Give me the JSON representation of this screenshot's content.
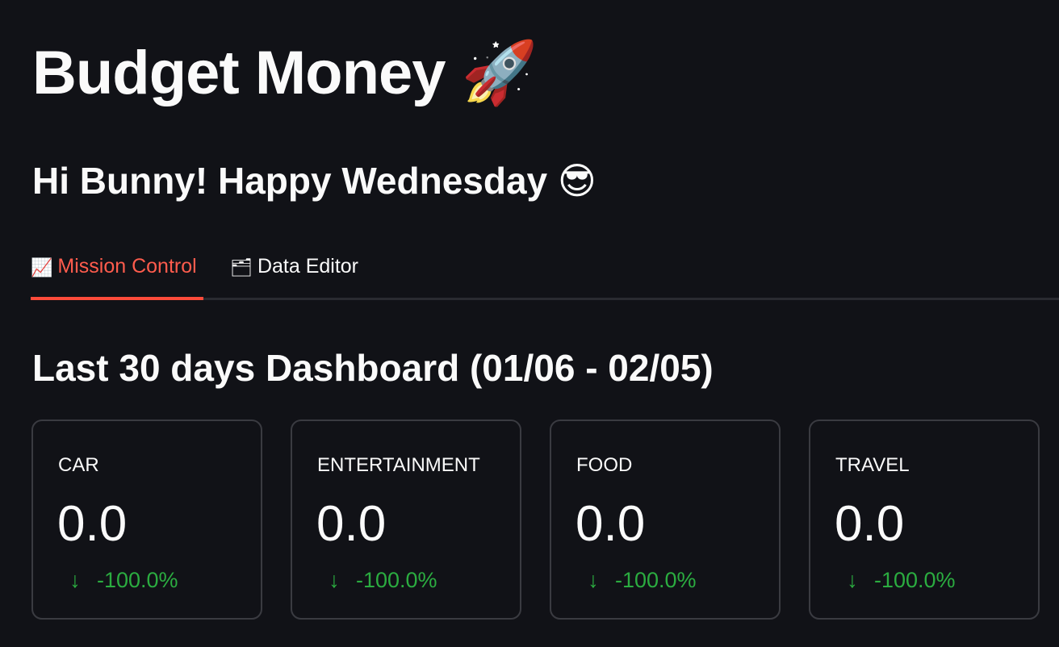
{
  "app": {
    "title": "Budget Money",
    "title_emoji": "🚀",
    "greeting": "Hi Bunny! Happy Wednesday",
    "greeting_emoji": "😎"
  },
  "tabs": [
    {
      "label": "Mission Control",
      "icon": "chart-increasing-icon",
      "icon_glyph": "📈",
      "selected": true
    },
    {
      "label": "Data Editor",
      "icon": "card-index-dividers-icon",
      "icon_glyph": "🗂",
      "selected": false
    }
  ],
  "dashboard": {
    "heading": "Last 30 days Dashboard (01/06 - 02/05)",
    "metrics": [
      {
        "label": "CAR",
        "value": "0.0",
        "delta": "-100.0%",
        "delta_direction": "down"
      },
      {
        "label": "ENTERTAINMENT",
        "value": "0.0",
        "delta": "-100.0%",
        "delta_direction": "down"
      },
      {
        "label": "FOOD",
        "value": "0.0",
        "delta": "-100.0%",
        "delta_direction": "down"
      },
      {
        "label": "TRAVEL",
        "value": "0.0",
        "delta": "-100.0%",
        "delta_direction": "down"
      }
    ],
    "delta_arrow_glyph": "↓"
  },
  "colors": {
    "background": "#111217",
    "text": "#fafafa",
    "accent": "#ff4b3a",
    "selected_tab_text": "#ff5c4d",
    "delta_negative": "#2bac40",
    "card_border": "#3a3b41",
    "tab_rule": "#2a2b31"
  }
}
